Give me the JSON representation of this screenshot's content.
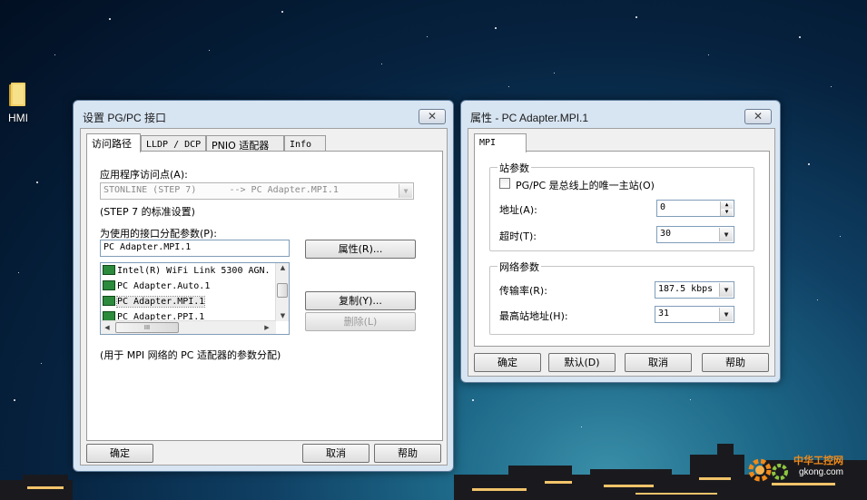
{
  "desktop": {
    "icon_label": "HMI"
  },
  "pgpc_window": {
    "title": "设置 PG/PC 接口",
    "close_glyph": "✕",
    "tabs": [
      {
        "label": "访问路径"
      },
      {
        "label": "LLDP / DCP"
      },
      {
        "label": "PNIO 适配器"
      },
      {
        "label": "Info"
      }
    ],
    "access_point_label": "应用程序访问点(A):",
    "access_point_value": "STONLINE (STEP 7)      --> PC Adapter.MPI.1",
    "step7_note": "(STEP 7 的标准设置)",
    "param_label": "为使用的接口分配参数(P):",
    "param_value": "PC Adapter.MPI.1",
    "list_items": [
      {
        "label": "Intel(R) WiFi Link 5300 AGN."
      },
      {
        "label": "PC Adapter.Auto.1"
      },
      {
        "label": "PC Adapter.MPI.1"
      },
      {
        "label": "PC Adapter.PPI.1"
      }
    ],
    "hscroll_grip": "III",
    "properties_button": "属性(R)...",
    "copy_button": "复制(Y)...",
    "delete_button": "删除(L)",
    "description": "(用于 MPI 网络的 PC 适配器的参数分配)",
    "ok_button": "确定",
    "cancel_button": "取消",
    "help_button": "帮助"
  },
  "props_window": {
    "title": "属性 - PC Adapter.MPI.1",
    "close_glyph": "✕",
    "tab_label": "MPI",
    "station_group": "站参数",
    "sole_master_label": "PG/PC 是总线上的唯一主站(O)",
    "address_label": "地址(A):",
    "address_value": "0",
    "timeout_label": "超时(T):",
    "timeout_value": "30",
    "network_group": "网络参数",
    "baud_label": "传输率(R):",
    "baud_value": "187.5 kbps",
    "highest_addr_label": "最高站地址(H):",
    "highest_addr_value": "31",
    "ok_button": "确定",
    "default_button": "默认(D)",
    "cancel_button": "取消",
    "help_button": "帮助"
  },
  "watermark": {
    "brand": "中华工控网",
    "site": "gkong.com"
  }
}
